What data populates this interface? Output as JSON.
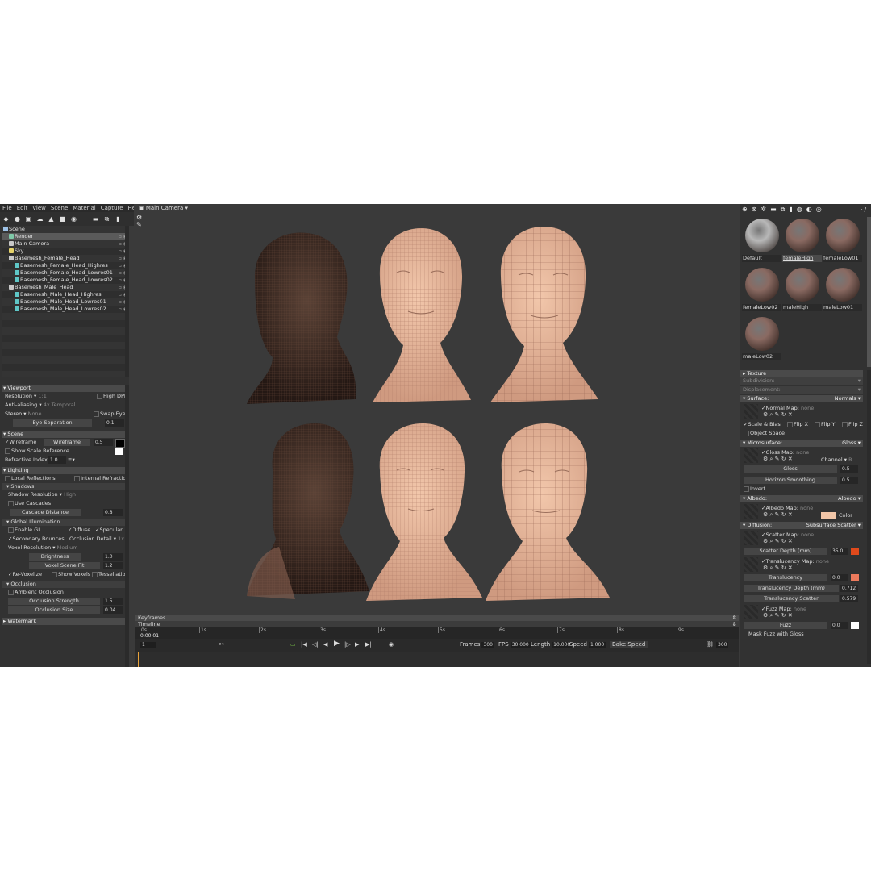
{
  "menu": [
    "File",
    "Edit",
    "View",
    "Scene",
    "Material",
    "Capture",
    "Help"
  ],
  "camera_label": "Main Camera ▾",
  "tree": [
    {
      "label": "Scene",
      "indent": 0,
      "color": "#9fc3e8",
      "sel": false,
      "eye": false
    },
    {
      "label": "Render",
      "indent": 1,
      "color": "#7fc9a8",
      "sel": true,
      "eye": true
    },
    {
      "label": "Main Camera",
      "indent": 1,
      "color": "#c8c8c8",
      "sel": false,
      "eye": true
    },
    {
      "label": "Sky",
      "indent": 1,
      "color": "#e6d36a",
      "sel": false,
      "eye": true
    },
    {
      "label": "Basemesh_Female_Head",
      "indent": 1,
      "color": "#c8c8c8",
      "sel": false,
      "eye": true
    },
    {
      "label": "Basemesh_Female_Head_Highres",
      "indent": 2,
      "color": "#5fc7c7",
      "sel": false,
      "eye": true
    },
    {
      "label": "Basemesh_Female_Head_Lowres01",
      "indent": 2,
      "color": "#5fc7c7",
      "sel": false,
      "eye": true
    },
    {
      "label": "Basemesh_Female_Head_Lowres02",
      "indent": 2,
      "color": "#5fc7c7",
      "sel": false,
      "eye": true
    },
    {
      "label": "Basemesh_Male_Head",
      "indent": 1,
      "color": "#c8c8c8",
      "sel": false,
      "eye": true
    },
    {
      "label": "Basemesh_Male_Head_Highres",
      "indent": 2,
      "color": "#5fc7c7",
      "sel": false,
      "eye": true
    },
    {
      "label": "Basemesh_Male_Head_Lowres01",
      "indent": 2,
      "color": "#5fc7c7",
      "sel": false,
      "eye": true
    },
    {
      "label": "Basemesh_Male_Head_Lowres02",
      "indent": 2,
      "color": "#5fc7c7",
      "sel": false,
      "eye": true
    }
  ],
  "left": {
    "viewport": "Viewport",
    "resolution": "Resolution ▾",
    "res_val": "1:1",
    "high_dpi": "High DPI",
    "aa": "Anti-aliasing ▾",
    "aa_val": "4x Temporal",
    "stereo": "Stereo ▾",
    "stereo_val": "None",
    "swap_eyes": "Swap Eyes",
    "eye_sep": "Eye Separation",
    "eye_sep_val": "0.1",
    "scene": "Scene",
    "wireframe": "Wireframe",
    "wireframe2": "Wireframe",
    "wire_val": "0.5",
    "scale_ref": "Show Scale Reference",
    "refr": "Refractive Index:",
    "refr_val": "1.0",
    "lighting": "Lighting",
    "local_refl": "Local Reflections",
    "internal_refr": "Internal Refraction",
    "shadows": "Shadows",
    "shadow_res": "Shadow Resolution ▾",
    "shadow_res_val": "High",
    "use_casc": "Use Cascades",
    "casc_dist": "Cascade Distance",
    "casc_val": "0.8",
    "gi": "Global Illumination",
    "enable_gi": "Enable GI",
    "diffuse": "Diffuse",
    "specular": "Specular",
    "sec_bounces": "Secondary Bounces",
    "occ_detail": "Occlusion Detail ▾",
    "occ_detail_val": "1x",
    "voxel_res": "Voxel Resolution ▾",
    "voxel_res_val": "Medium",
    "brightness": "Brightness",
    "bright_val": "1.0",
    "voxel_fit": "Voxel Scene Fit",
    "voxel_fit_val": "1.2",
    "revox": "Re-Voxelize",
    "show_vox": "Show Voxels",
    "tess": "Tessellation",
    "occlusion": "Occlusion",
    "ambient_occ": "Ambient Occlusion",
    "occ_str": "Occlusion Strength",
    "occ_str_val": "1.5",
    "occ_size": "Occlusion Size",
    "occ_size_val": "0.04",
    "watermark": "Watermark"
  },
  "timeline": {
    "keyframes": "Keyframes",
    "timeline": "Timeline",
    "time": "0:00.01",
    "ticks": [
      "0s",
      "1s",
      "2s",
      "3s",
      "4s",
      "5s",
      "6s",
      "7s",
      "8s",
      "9s"
    ],
    "frame": "1",
    "frames_label": "Frames",
    "frames": "300",
    "fps_label": "FPS",
    "fps": "30.000",
    "length_label": "Length",
    "length": "10.000",
    "speed_label": "Speed",
    "speed": "1.000",
    "bake": "Bake Speed",
    "end": "300"
  },
  "right": {
    "top_right": "- /",
    "materials": [
      {
        "name": "Default",
        "color": "#b8b8b8"
      },
      {
        "name": "femaleHigh",
        "color": "#8a6a62",
        "sel": true
      },
      {
        "name": "femaleLow01",
        "color": "#8a6a62"
      },
      {
        "name": "femaleLow02",
        "color": "#8a6a62"
      },
      {
        "name": "maleHigh",
        "color": "#8a6a62"
      },
      {
        "name": "maleLow01",
        "color": "#8a6a62"
      },
      {
        "name": "maleLow02",
        "color": "#8a6a62"
      }
    ],
    "texture": "Texture",
    "subdivision": "Subdivision:",
    "displacement": "Displacement:",
    "surface": "Surface:",
    "surface_val": "Normals",
    "normal_map": "Normal Map:",
    "none": "none",
    "scale_bias": "Scale & Bias",
    "flip_x": "Flip X",
    "flip_y": "Flip Y",
    "flip_z": "Flip Z",
    "object_space": "Object Space",
    "micro": "Microsurface:",
    "micro_val": "Gloss",
    "gloss_map": "Gloss Map:",
    "channel": "Channel ▾",
    "channel_val": "R",
    "gloss": "Gloss",
    "gloss_val": "0.5",
    "horizon": "Horizon Smoothing",
    "horizon_val": "0.5",
    "invert": "Invert",
    "albedo": "Albedo:",
    "albedo_val": "Albedo",
    "albedo_map": "Albedo Map:",
    "color": "Color",
    "diffusion": "Diffusion:",
    "diffusion_val": "Subsurface Scatter",
    "scatter_map": "Scatter Map:",
    "scatter_depth": "Scatter Depth (mm)",
    "scatter_depth_val": "35.0",
    "transl_map": "Translucency Map:",
    "translucency": "Translucency",
    "transl_val": "0.0",
    "transl_depth": "Translucency Depth (mm)",
    "transl_depth_val": "0.712",
    "transl_scatter": "Translucency Scatter",
    "transl_scatter_val": "0.579",
    "fuzz_map": "Fuzz Map:",
    "fuzz": "Fuzz",
    "fuzz_val": "0.0",
    "mask_fuzz": "Mask Fuzz with Gloss"
  },
  "colors": {
    "albedo_swatch": "#f2c6a8",
    "scatter_swatch": "#e04a1c",
    "transl_swatch": "#ec7a5c",
    "skin_light": "#e9b79b",
    "skin_dark": "#3a2a22"
  }
}
